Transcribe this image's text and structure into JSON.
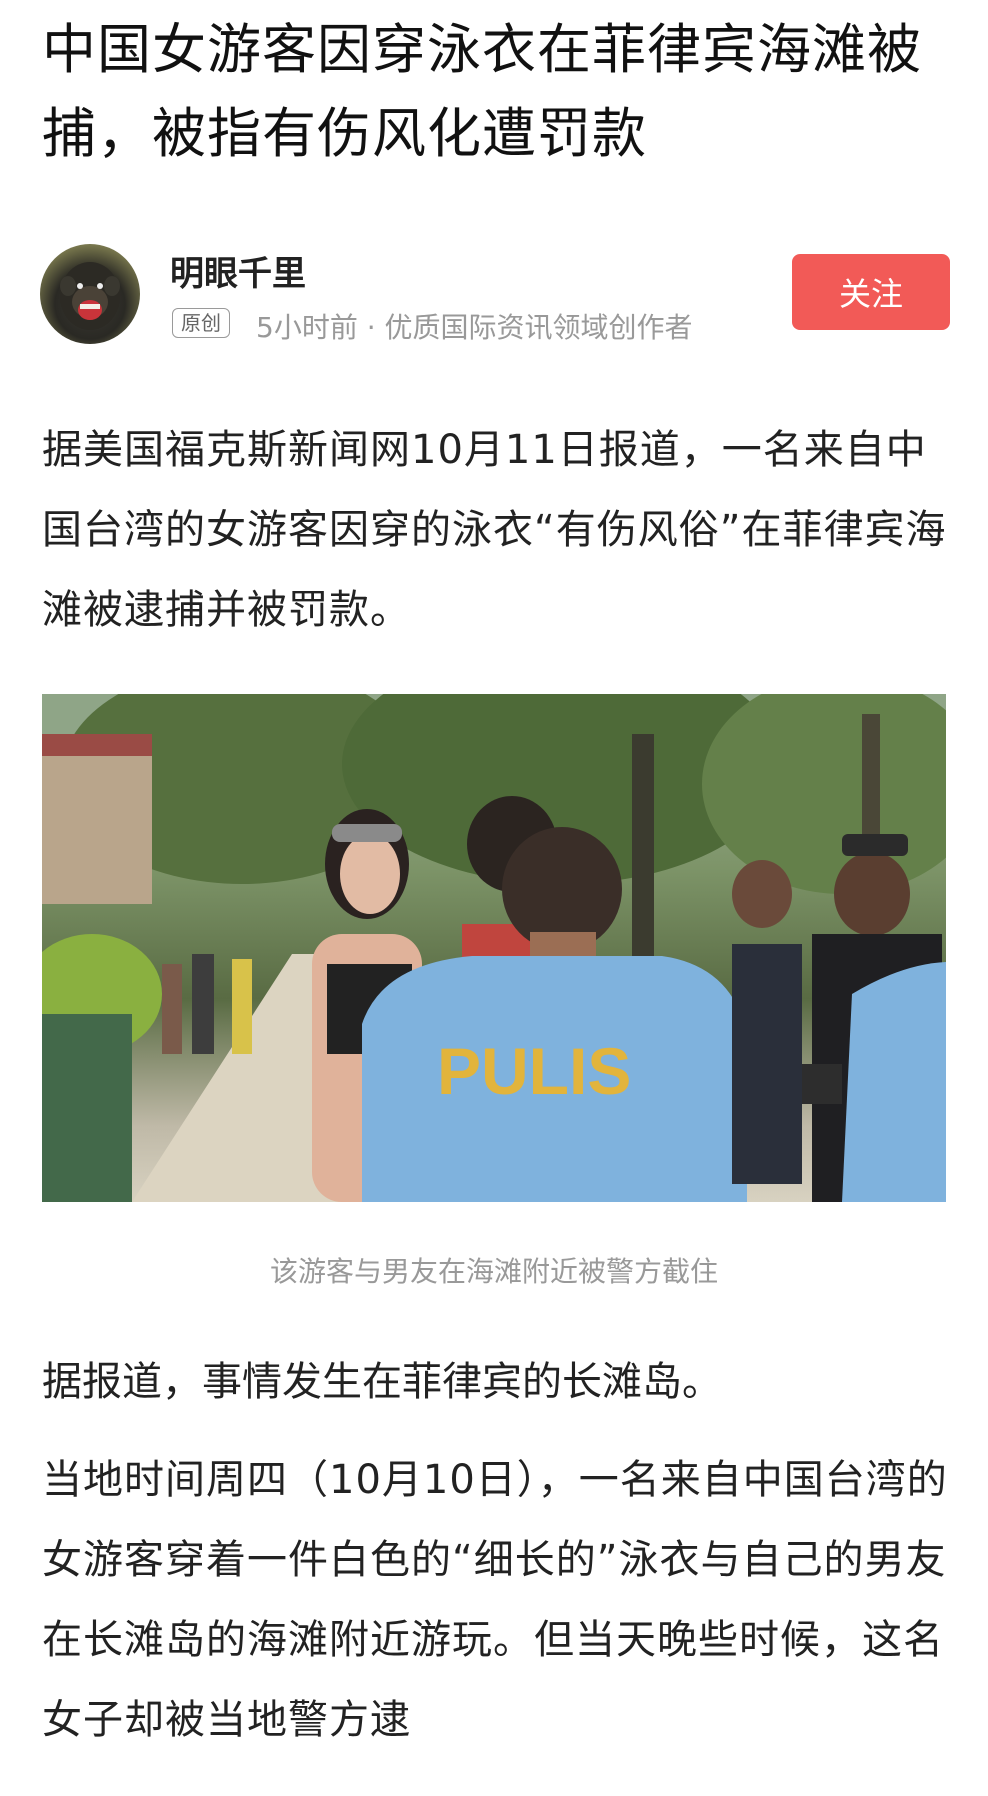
{
  "article": {
    "title": "中国女游客因穿泳衣在菲律宾海滩被捕，被指有伤风化遭罚款",
    "author": {
      "name": "明眼千里",
      "badge": "原创",
      "meta": "5小时前 · 优质国际资讯领域创作者",
      "avatar_icon": "chimpanzee-avatar"
    },
    "follow_label": "关注",
    "paragraphs": [
      "据美国福克斯新闻网10月11日报道，一名来自中国台湾的女游客因穿的泳衣“有伤风俗”在菲律宾海滩被逮捕并被罚款。",
      "据报道，事情发生在菲律宾的长滩岛。",
      "当地时间周四（10月10日），一名来自中国台湾的女游客穿着一件白色的“细长的”泳衣与自己的男友在长滩岛的海滩附近游玩。但当天晚些时候，这名女子却被当地警方逮"
    ],
    "photo": {
      "shirt_text": "PULIS",
      "caption": "该游客与男友在海滩附近被警方截住"
    }
  },
  "colors": {
    "follow_button": "#f25a57",
    "police_shirt": "#7fb2dd",
    "shirt_lettering": "#e2b43c"
  }
}
